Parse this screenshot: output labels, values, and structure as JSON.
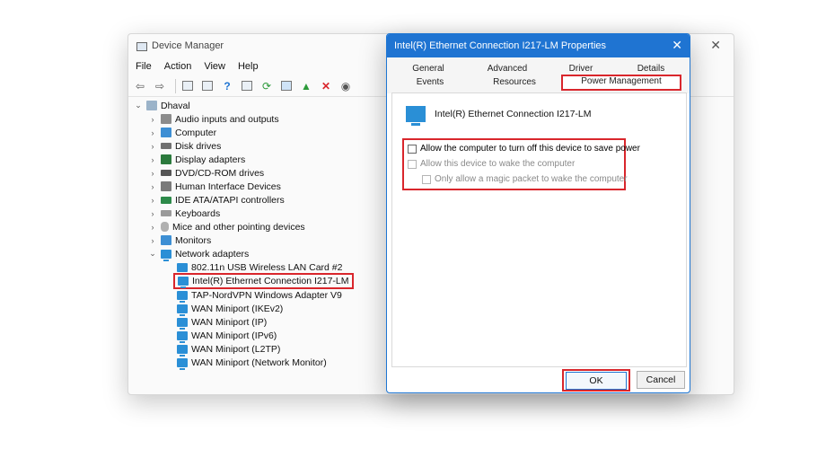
{
  "device_manager": {
    "title": "Device Manager",
    "menu": [
      "File",
      "Action",
      "View",
      "Help"
    ],
    "tree": {
      "root": "Dhaval",
      "categories": [
        {
          "label": "Audio inputs and outputs"
        },
        {
          "label": "Computer"
        },
        {
          "label": "Disk drives"
        },
        {
          "label": "Display adapters"
        },
        {
          "label": "DVD/CD-ROM drives"
        },
        {
          "label": "Human Interface Devices"
        },
        {
          "label": "IDE ATA/ATAPI controllers"
        },
        {
          "label": "Keyboards"
        },
        {
          "label": "Mice and other pointing devices"
        },
        {
          "label": "Monitors"
        },
        {
          "label": "Network adapters"
        }
      ],
      "network_adapters": [
        "802.11n USB Wireless LAN Card #2",
        "Intel(R) Ethernet Connection I217-LM",
        "TAP-NordVPN Windows Adapter V9",
        "WAN Miniport (IKEv2)",
        "WAN Miniport (IP)",
        "WAN Miniport (IPv6)",
        "WAN Miniport (L2TP)",
        "WAN Miniport (Network Monitor)"
      ],
      "selected": "Intel(R) Ethernet Connection I217-LM"
    }
  },
  "properties_dialog": {
    "title": "Intel(R) Ethernet Connection I217-LM Properties",
    "tabs_row1": [
      "General",
      "Advanced",
      "Driver",
      "Details"
    ],
    "tabs_row2": [
      "Events",
      "Resources",
      "Power Management"
    ],
    "active_tab": "Power Management",
    "device_name": "Intel(R) Ethernet Connection I217-LM",
    "options": [
      {
        "label": "Allow the computer to turn off this device to save power",
        "checked": false,
        "enabled": true
      },
      {
        "label": "Allow this device to wake the computer",
        "checked": false,
        "enabled": false
      },
      {
        "label": "Only allow a magic packet to wake the computer",
        "checked": false,
        "enabled": false
      }
    ],
    "ok_label": "OK",
    "cancel_label": "Cancel"
  },
  "colors": {
    "highlight": "#d9262c",
    "titlebar_accent": "#1f74d2",
    "network_icon": "#2a8fd6"
  }
}
